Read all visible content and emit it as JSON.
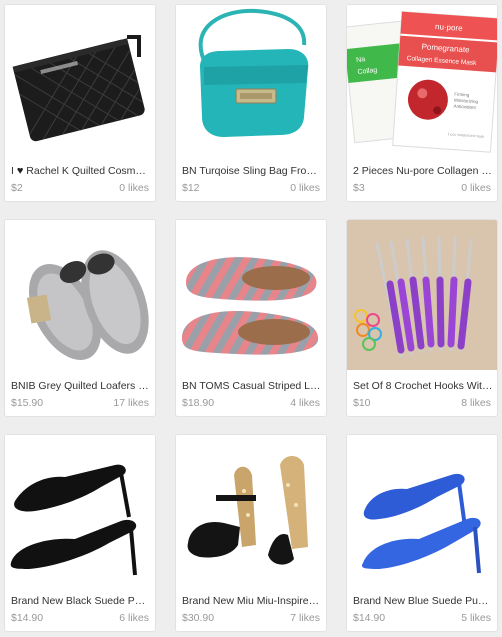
{
  "listings": [
    {
      "title_prefix": "I ",
      "title_heart": "♥",
      "title": " Rachel K Quilted Cosm…",
      "price": "$2",
      "likes": "0 likes",
      "image": "black-quilted-pouch"
    },
    {
      "title": "BN Turqoise Sling Bag From…",
      "price": "$12",
      "likes": "0 likes",
      "image": "turquoise-sling-bag"
    },
    {
      "title": "2 Pieces Nu-pore Collagen …",
      "price": "$3",
      "likes": "0 likes",
      "image": "collagen-masks",
      "product_text": {
        "brand": "nu·pore",
        "name_line1": "Pomegranate",
        "name_line2": "Collagen Essence Mask",
        "back_fragment": "Na",
        "back_fragment2": "Collag",
        "benefits": [
          "Firming",
          "Moisturizing",
          "Antioxidant"
        ],
        "bottom_note": "1 pcs moisturized mask"
      }
    },
    {
      "title": "BNIB Grey Quilted Loafers (…",
      "price": "$15.90",
      "likes": "17 likes",
      "image": "grey-quilted-loafers"
    },
    {
      "title": "BN TOMS Casual Striped Lo…",
      "price": "$18.90",
      "likes": "4 likes",
      "image": "striped-toms"
    },
    {
      "title": "Set Of 8 Crochet Hooks Wit…",
      "price": "$10",
      "likes": "8 likes",
      "image": "crochet-hooks"
    },
    {
      "title": "Brand New Black Suede Pu…",
      "price": "$14.90",
      "likes": "6 likes",
      "image": "black-suede-pumps"
    },
    {
      "title": "Brand New Miu Miu-Inspired…",
      "price": "$30.90",
      "likes": "7 likes",
      "image": "glitter-platform-heels"
    },
    {
      "title": "Brand New Blue Suede Pu…",
      "price": "$14.90",
      "likes": "5 likes",
      "image": "blue-suede-pumps"
    }
  ],
  "colors": {
    "page_bg": "#eeeeee",
    "card_bg": "#ffffff",
    "title": "#333333",
    "meta": "#999999"
  }
}
